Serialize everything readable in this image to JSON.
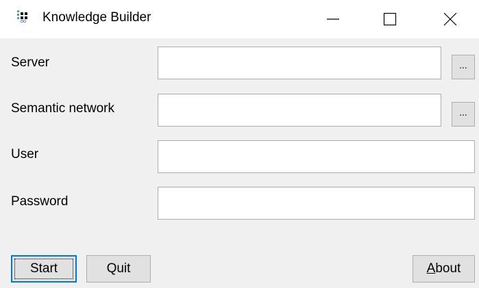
{
  "window": {
    "title": "Knowledge Builder",
    "controls": {
      "minimize": "minimize-icon",
      "maximize": "maximize-icon",
      "close": "close-icon"
    }
  },
  "form": {
    "server_label": "Server",
    "server_value": "",
    "semantic_network_label": "Semantic network",
    "semantic_network_value": "",
    "user_label": "User",
    "user_value": "",
    "password_label": "Password",
    "password_value": "",
    "browse_label": "..."
  },
  "buttons": {
    "start_label": "Start",
    "quit_label": "Quit",
    "about_first": "A",
    "about_rest": "bout"
  },
  "colors": {
    "focus_border": "#0078d7",
    "button_face": "#e1e1e1",
    "window_bg": "#f0f0f0"
  }
}
